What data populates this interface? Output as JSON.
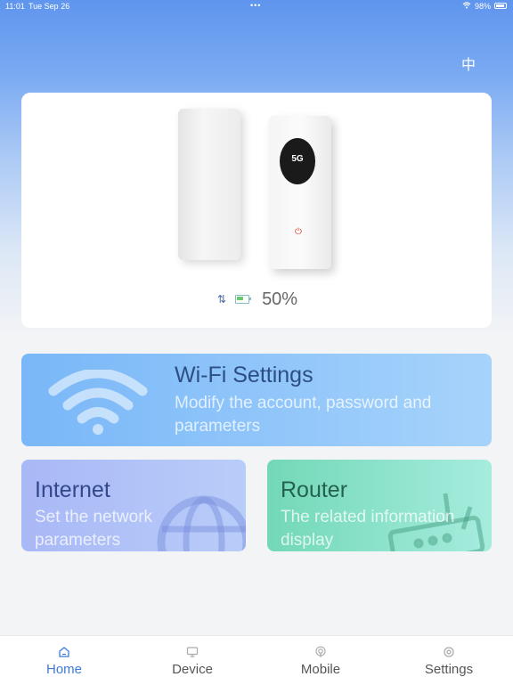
{
  "status_bar": {
    "time": "11:01",
    "date": "Tue Sep 26",
    "battery": "98%"
  },
  "header": {
    "language_button": "中"
  },
  "device": {
    "screen_label": "5G",
    "battery_percent": "50%",
    "battery_level": 0.5
  },
  "cards": {
    "wifi": {
      "title": "Wi-Fi Settings",
      "subtitle": "Modify the account, password and parameters"
    },
    "internet": {
      "title": "Internet",
      "subtitle": "Set the network parameters"
    },
    "router": {
      "title": "Router",
      "subtitle": "The related information display"
    }
  },
  "tabbar": {
    "tabs": [
      {
        "label": "Home",
        "icon": "home-icon",
        "active": true
      },
      {
        "label": "Device",
        "icon": "monitor-icon",
        "active": false
      },
      {
        "label": "Mobile",
        "icon": "signal-icon",
        "active": false
      },
      {
        "label": "Settings",
        "icon": "gear-icon",
        "active": false
      }
    ]
  },
  "colors": {
    "accent": "#3d7bd9",
    "battery_fill": "#66c96a"
  }
}
